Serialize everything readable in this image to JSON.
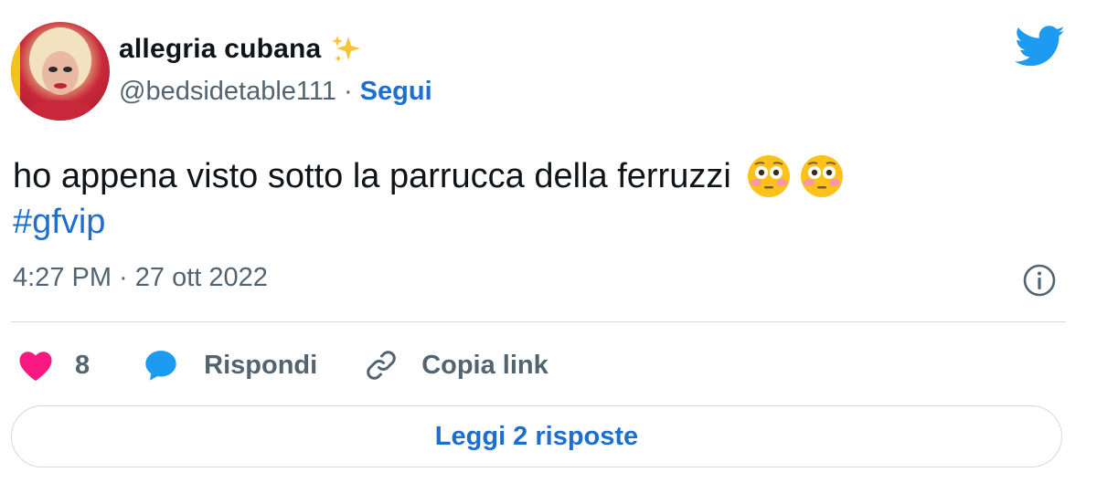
{
  "tweet": {
    "author_name": "allegria cubana",
    "author_handle": "@bedsidetable111",
    "separator": "·",
    "follow_label": "Segui",
    "text": "ho appena visto sotto la parrucca della ferruzzi",
    "hashtag": "#gfvip",
    "time": "4:27 PM",
    "date": "27 ott 2022",
    "meta_separator": " · "
  },
  "actions": {
    "like_count": "8",
    "reply_label": "Rispondi",
    "copy_link_label": "Copia link"
  },
  "footer": {
    "read_replies_label": "Leggi 2 risposte"
  },
  "colors": {
    "link_blue": "#1d6fcf",
    "twitter_blue": "#1d9bf0",
    "like_pink": "#f91880",
    "muted_gray": "#536471"
  },
  "icons": {
    "verified_emoji": "sparkles-icon",
    "brand": "twitter-bird-icon",
    "flushed_emoji": "flushed-face-icon",
    "info": "info-icon",
    "like": "heart-icon",
    "reply": "speech-bubble-icon",
    "copy_link": "link-icon"
  }
}
